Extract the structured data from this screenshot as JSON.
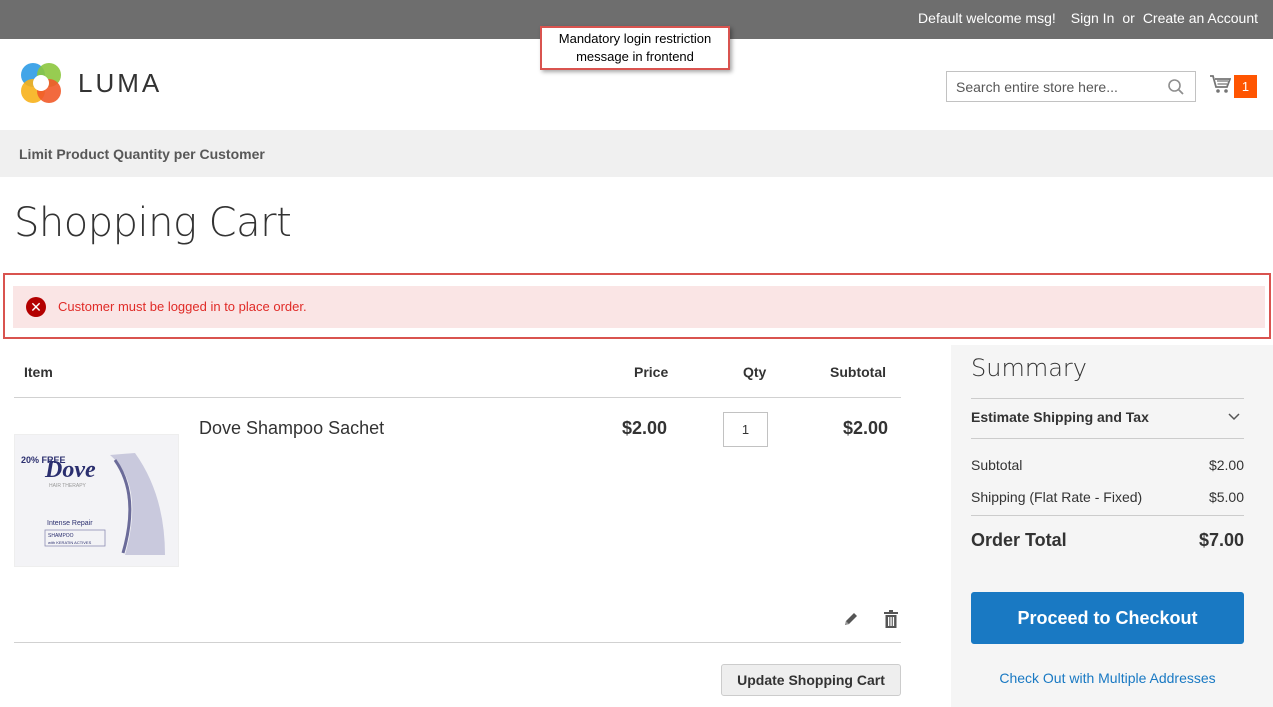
{
  "topbar": {
    "welcome": "Default welcome msg!",
    "sign_in": "Sign In",
    "or": "or",
    "create_account": "Create an Account"
  },
  "annotation": {
    "line1": "Mandatory login restriction",
    "line2": "message in frontend"
  },
  "header": {
    "logo_text": "LUMA",
    "search_placeholder": "Search entire store here...",
    "cart_count": "1"
  },
  "nav": {
    "items": [
      {
        "label": "Limit Product Quantity per Customer"
      }
    ]
  },
  "page": {
    "title": "Shopping Cart",
    "error_message": "Customer must be logged in to place order."
  },
  "cart": {
    "headers": {
      "item": "Item",
      "price": "Price",
      "qty": "Qty",
      "subtotal": "Subtotal"
    },
    "rows": [
      {
        "name": "Dove Shampoo Sachet",
        "price": "$2.00",
        "qty": "1",
        "subtotal": "$2.00",
        "image_text": {
          "brand": "Dove",
          "badge": "20% FREE",
          "tagline": "HAIR THERAPY",
          "variant": "Intense Repair",
          "product": "SHAMPOO",
          "actives": "with KERATIN ACTIVES"
        }
      }
    ],
    "update_label": "Update Shopping Cart"
  },
  "summary": {
    "title": "Summary",
    "estimate_label": "Estimate Shipping and Tax",
    "subtotal_label": "Subtotal",
    "subtotal_value": "$2.00",
    "shipping_label": "Shipping (Flat Rate - Fixed)",
    "shipping_value": "$5.00",
    "total_label": "Order Total",
    "total_value": "$7.00",
    "checkout_label": "Proceed to Checkout",
    "multi_label": "Check Out with Multiple Addresses"
  },
  "colors": {
    "topbar": "#6e6e6e",
    "accent": "#1979c3",
    "cart_badge": "#ff5501",
    "error_bg": "#fae5e5",
    "error_text": "#e02b27",
    "annotation_border": "#d9534f"
  }
}
